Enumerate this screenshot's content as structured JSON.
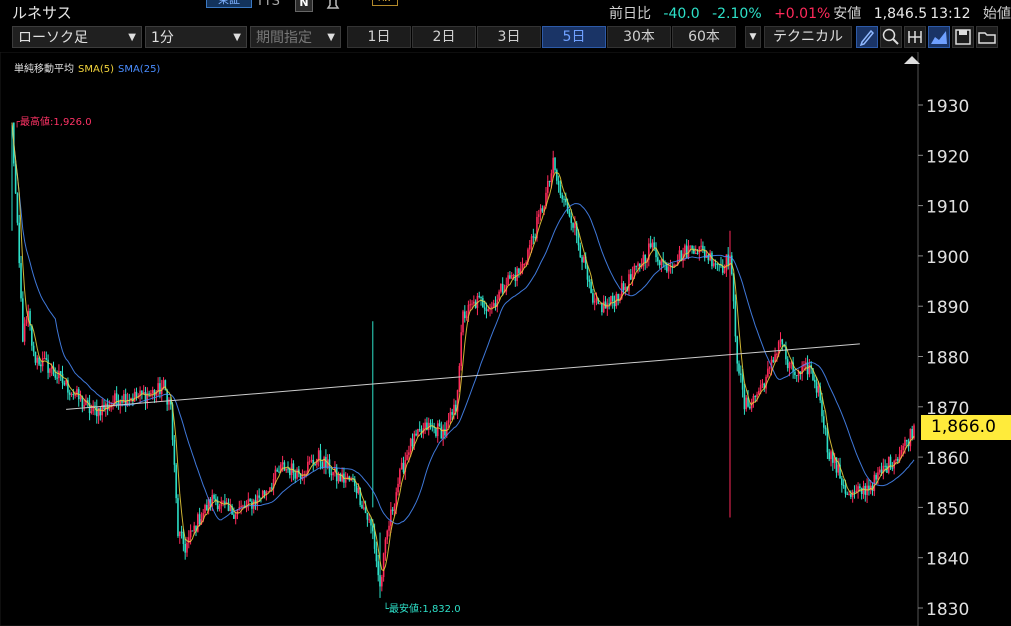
{
  "header": {
    "stock_name": "ルネサス",
    "exchange_badge": "東証",
    "code_fragment": "TTS",
    "n_badge": "N",
    "tag_badge": "AW",
    "change_label": "前日比",
    "change": "-40.0",
    "change_pct": "-2.10%",
    "other_pct": "+0.01%",
    "price_label": "安値",
    "price": "1,846.5",
    "time": "13:12",
    "open_label": "始値"
  },
  "toolbar": {
    "chart_type": "ローソク足",
    "interval": "1分",
    "period": "期間指定",
    "ranges": [
      "1日",
      "2日",
      "3日",
      "5日",
      "30本",
      "60本"
    ],
    "active_range": "5日",
    "technical": "テクニカル"
  },
  "colors": {
    "up": "#ff2a5a",
    "down": "#2de0c8",
    "sma5": "#f2d43c",
    "sma25": "#4a8dff",
    "trend": "#cccccc",
    "high_label": "#ff3366",
    "low_label": "#2de0c8",
    "current_bg": "#ffeb3b"
  },
  "legend": {
    "title": "単純移動平均",
    "sma5": "SMA(5)",
    "sma25": "SMA(25)"
  },
  "annotations": {
    "high": "最高値:1,926.0",
    "low": "最安値:1,832.0"
  },
  "current_price_label": "1,866.0",
  "chart_data": {
    "type": "candlestick",
    "title": "",
    "xlabel": "",
    "ylabel": "",
    "ylim": [
      1827,
      1940
    ],
    "y_ticks": [
      1830,
      1840,
      1850,
      1860,
      1870,
      1880,
      1890,
      1900,
      1910,
      1920,
      1930
    ],
    "interval": "1分",
    "range": "5日",
    "series_hint": "5 trading days of 1-minute candles",
    "close_path": [
      [
        0,
        1926
      ],
      [
        3,
        1905
      ],
      [
        6,
        1884
      ],
      [
        9,
        1888
      ],
      [
        12,
        1880
      ],
      [
        20,
        1878
      ],
      [
        28,
        1875
      ],
      [
        36,
        1872
      ],
      [
        44,
        1869
      ],
      [
        52,
        1870
      ],
      [
        60,
        1872
      ],
      [
        70,
        1872
      ],
      [
        80,
        1873
      ],
      [
        84,
        1874
      ],
      [
        88,
        1870
      ],
      [
        92,
        1845
      ],
      [
        96,
        1842
      ],
      [
        104,
        1848
      ],
      [
        112,
        1852
      ],
      [
        120,
        1849
      ],
      [
        130,
        1850
      ],
      [
        140,
        1853
      ],
      [
        150,
        1858
      ],
      [
        160,
        1857
      ],
      [
        170,
        1860
      ],
      [
        180,
        1856
      ],
      [
        190,
        1855
      ],
      [
        200,
        1845
      ],
      [
        204,
        1834
      ],
      [
        208,
        1845
      ],
      [
        214,
        1855
      ],
      [
        220,
        1862
      ],
      [
        230,
        1866
      ],
      [
        240,
        1865
      ],
      [
        246,
        1870
      ],
      [
        250,
        1888
      ],
      [
        258,
        1891
      ],
      [
        266,
        1890
      ],
      [
        274,
        1895
      ],
      [
        282,
        1897
      ],
      [
        290,
        1905
      ],
      [
        296,
        1912
      ],
      [
        300,
        1918
      ],
      [
        304,
        1912
      ],
      [
        310,
        1908
      ],
      [
        316,
        1900
      ],
      [
        322,
        1890
      ],
      [
        330,
        1890
      ],
      [
        338,
        1893
      ],
      [
        346,
        1897
      ],
      [
        354,
        1902
      ],
      [
        362,
        1898
      ],
      [
        370,
        1900
      ],
      [
        378,
        1902
      ],
      [
        386,
        1900
      ],
      [
        394,
        1898
      ],
      [
        398,
        1900
      ],
      [
        402,
        1880
      ],
      [
        406,
        1870
      ],
      [
        412,
        1872
      ],
      [
        420,
        1877
      ],
      [
        426,
        1884
      ],
      [
        430,
        1878
      ],
      [
        436,
        1876
      ],
      [
        442,
        1878
      ],
      [
        448,
        1872
      ],
      [
        452,
        1862
      ],
      [
        458,
        1857
      ],
      [
        464,
        1852
      ],
      [
        470,
        1853
      ],
      [
        478,
        1855
      ],
      [
        484,
        1858
      ],
      [
        490,
        1860
      ],
      [
        496,
        1863
      ],
      [
        500,
        1866
      ]
    ],
    "trend_line": {
      "from": [
        30,
        1869.5
      ],
      "to": [
        470,
        1882.5
      ]
    }
  }
}
